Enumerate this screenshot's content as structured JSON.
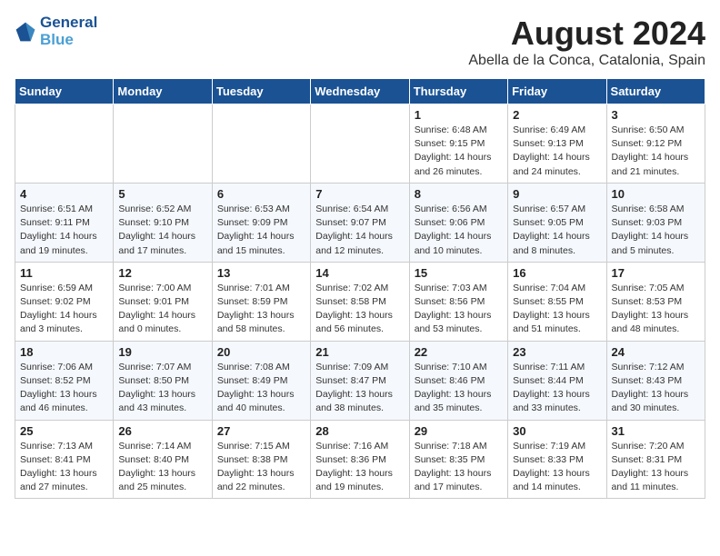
{
  "header": {
    "logo_line1": "General",
    "logo_line2": "Blue",
    "month_year": "August 2024",
    "location": "Abella de la Conca, Catalonia, Spain"
  },
  "weekdays": [
    "Sunday",
    "Monday",
    "Tuesday",
    "Wednesday",
    "Thursday",
    "Friday",
    "Saturday"
  ],
  "weeks": [
    [
      {
        "day": "",
        "info": ""
      },
      {
        "day": "",
        "info": ""
      },
      {
        "day": "",
        "info": ""
      },
      {
        "day": "",
        "info": ""
      },
      {
        "day": "1",
        "info": "Sunrise: 6:48 AM\nSunset: 9:15 PM\nDaylight: 14 hours\nand 26 minutes."
      },
      {
        "day": "2",
        "info": "Sunrise: 6:49 AM\nSunset: 9:13 PM\nDaylight: 14 hours\nand 24 minutes."
      },
      {
        "day": "3",
        "info": "Sunrise: 6:50 AM\nSunset: 9:12 PM\nDaylight: 14 hours\nand 21 minutes."
      }
    ],
    [
      {
        "day": "4",
        "info": "Sunrise: 6:51 AM\nSunset: 9:11 PM\nDaylight: 14 hours\nand 19 minutes."
      },
      {
        "day": "5",
        "info": "Sunrise: 6:52 AM\nSunset: 9:10 PM\nDaylight: 14 hours\nand 17 minutes."
      },
      {
        "day": "6",
        "info": "Sunrise: 6:53 AM\nSunset: 9:09 PM\nDaylight: 14 hours\nand 15 minutes."
      },
      {
        "day": "7",
        "info": "Sunrise: 6:54 AM\nSunset: 9:07 PM\nDaylight: 14 hours\nand 12 minutes."
      },
      {
        "day": "8",
        "info": "Sunrise: 6:56 AM\nSunset: 9:06 PM\nDaylight: 14 hours\nand 10 minutes."
      },
      {
        "day": "9",
        "info": "Sunrise: 6:57 AM\nSunset: 9:05 PM\nDaylight: 14 hours\nand 8 minutes."
      },
      {
        "day": "10",
        "info": "Sunrise: 6:58 AM\nSunset: 9:03 PM\nDaylight: 14 hours\nand 5 minutes."
      }
    ],
    [
      {
        "day": "11",
        "info": "Sunrise: 6:59 AM\nSunset: 9:02 PM\nDaylight: 14 hours\nand 3 minutes."
      },
      {
        "day": "12",
        "info": "Sunrise: 7:00 AM\nSunset: 9:01 PM\nDaylight: 14 hours\nand 0 minutes."
      },
      {
        "day": "13",
        "info": "Sunrise: 7:01 AM\nSunset: 8:59 PM\nDaylight: 13 hours\nand 58 minutes."
      },
      {
        "day": "14",
        "info": "Sunrise: 7:02 AM\nSunset: 8:58 PM\nDaylight: 13 hours\nand 56 minutes."
      },
      {
        "day": "15",
        "info": "Sunrise: 7:03 AM\nSunset: 8:56 PM\nDaylight: 13 hours\nand 53 minutes."
      },
      {
        "day": "16",
        "info": "Sunrise: 7:04 AM\nSunset: 8:55 PM\nDaylight: 13 hours\nand 51 minutes."
      },
      {
        "day": "17",
        "info": "Sunrise: 7:05 AM\nSunset: 8:53 PM\nDaylight: 13 hours\nand 48 minutes."
      }
    ],
    [
      {
        "day": "18",
        "info": "Sunrise: 7:06 AM\nSunset: 8:52 PM\nDaylight: 13 hours\nand 46 minutes."
      },
      {
        "day": "19",
        "info": "Sunrise: 7:07 AM\nSunset: 8:50 PM\nDaylight: 13 hours\nand 43 minutes."
      },
      {
        "day": "20",
        "info": "Sunrise: 7:08 AM\nSunset: 8:49 PM\nDaylight: 13 hours\nand 40 minutes."
      },
      {
        "day": "21",
        "info": "Sunrise: 7:09 AM\nSunset: 8:47 PM\nDaylight: 13 hours\nand 38 minutes."
      },
      {
        "day": "22",
        "info": "Sunrise: 7:10 AM\nSunset: 8:46 PM\nDaylight: 13 hours\nand 35 minutes."
      },
      {
        "day": "23",
        "info": "Sunrise: 7:11 AM\nSunset: 8:44 PM\nDaylight: 13 hours\nand 33 minutes."
      },
      {
        "day": "24",
        "info": "Sunrise: 7:12 AM\nSunset: 8:43 PM\nDaylight: 13 hours\nand 30 minutes."
      }
    ],
    [
      {
        "day": "25",
        "info": "Sunrise: 7:13 AM\nSunset: 8:41 PM\nDaylight: 13 hours\nand 27 minutes."
      },
      {
        "day": "26",
        "info": "Sunrise: 7:14 AM\nSunset: 8:40 PM\nDaylight: 13 hours\nand 25 minutes."
      },
      {
        "day": "27",
        "info": "Sunrise: 7:15 AM\nSunset: 8:38 PM\nDaylight: 13 hours\nand 22 minutes."
      },
      {
        "day": "28",
        "info": "Sunrise: 7:16 AM\nSunset: 8:36 PM\nDaylight: 13 hours\nand 19 minutes."
      },
      {
        "day": "29",
        "info": "Sunrise: 7:18 AM\nSunset: 8:35 PM\nDaylight: 13 hours\nand 17 minutes."
      },
      {
        "day": "30",
        "info": "Sunrise: 7:19 AM\nSunset: 8:33 PM\nDaylight: 13 hours\nand 14 minutes."
      },
      {
        "day": "31",
        "info": "Sunrise: 7:20 AM\nSunset: 8:31 PM\nDaylight: 13 hours\nand 11 minutes."
      }
    ]
  ]
}
